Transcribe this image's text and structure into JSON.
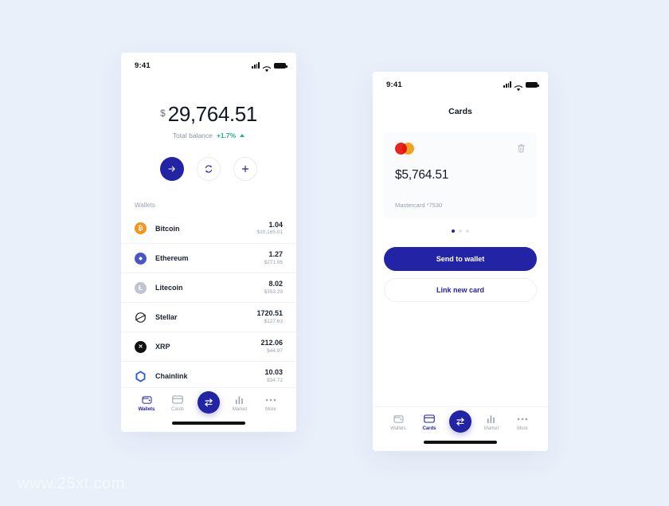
{
  "canvas": {
    "background": "#eaf0fa",
    "watermark": "www.25xt.com"
  },
  "theme": {
    "accent": "#2323a5",
    "positive": "#23b57e",
    "muted": "#9aa2b1",
    "text": "#111827",
    "card_bg": "#fafbfd"
  },
  "phone_wallets": {
    "status": {
      "time": "9:41",
      "signal_icon": "cellular-signal-icon",
      "wifi_icon": "wifi-icon",
      "battery_icon": "battery-icon"
    },
    "balance": {
      "currency_symbol": "$",
      "amount": "29,764.51",
      "caption": "Total balance",
      "change": "+1.7%",
      "change_direction": "up"
    },
    "actions": [
      {
        "name": "send-button",
        "icon": "arrow-right-icon",
        "style": "primary"
      },
      {
        "name": "swap-button",
        "icon": "refresh-swap-icon",
        "style": "ghost"
      },
      {
        "name": "add-button",
        "icon": "plus-icon",
        "style": "ghost"
      }
    ],
    "wallets_label": "Wallets",
    "wallets": [
      {
        "name": "Bitcoin",
        "icon": "bitcoin-icon",
        "symbol": "₿",
        "color": "#f7931a",
        "amount": "1.04",
        "fiat": "$10,165.01"
      },
      {
        "name": "Ethereum",
        "icon": "ethereum-icon",
        "symbol": "◆",
        "color": "#4a55c7",
        "amount": "1.27",
        "fiat": "$271.06"
      },
      {
        "name": "Litecoin",
        "icon": "litecoin-icon",
        "symbol": "Ł",
        "color": "#bfc5d0",
        "amount": "8.02",
        "fiat": "$353.29"
      },
      {
        "name": "Stellar",
        "icon": "stellar-icon",
        "symbol": "⊘",
        "color": "#ffffff",
        "amount": "1720.51",
        "fiat": "$127.63"
      },
      {
        "name": "XRP",
        "icon": "xrp-icon",
        "symbol": "✕",
        "color": "#1a1a1a",
        "amount": "212.06",
        "fiat": "$44.97"
      },
      {
        "name": "Chainlink",
        "icon": "chainlink-icon",
        "symbol": "⬡",
        "color": "#ffffff",
        "amount": "10.03",
        "fiat": "$34.72"
      }
    ],
    "tabs": [
      {
        "label": "Wallets",
        "icon": "wallet-icon",
        "active": true
      },
      {
        "label": "Cards",
        "icon": "card-icon",
        "active": false
      },
      {
        "label": "",
        "icon": "exchange-icon",
        "active": false,
        "fab": true
      },
      {
        "label": "Market",
        "icon": "bar-chart-icon",
        "active": false
      },
      {
        "label": "More",
        "icon": "ellipsis-icon",
        "active": false
      }
    ]
  },
  "phone_cards": {
    "status": {
      "time": "9:41",
      "signal_icon": "cellular-signal-icon",
      "wifi_icon": "wifi-icon",
      "battery_icon": "battery-icon"
    },
    "title": "Cards",
    "card": {
      "brand_icon": "mastercard-logo",
      "delete_icon": "trash-icon",
      "amount": "$5,764.51",
      "meta": "Mastercard *7530"
    },
    "pagination": {
      "count": 3,
      "active_index": 0
    },
    "buttons": {
      "primary": "Send to wallet",
      "secondary": "Link new card"
    },
    "tabs": [
      {
        "label": "Wallets",
        "icon": "wallet-icon",
        "active": false
      },
      {
        "label": "Cards",
        "icon": "card-icon",
        "active": true
      },
      {
        "label": "",
        "icon": "exchange-icon",
        "active": false,
        "fab": true
      },
      {
        "label": "Market",
        "icon": "bar-chart-icon",
        "active": false
      },
      {
        "label": "More",
        "icon": "ellipsis-icon",
        "active": false
      }
    ]
  }
}
